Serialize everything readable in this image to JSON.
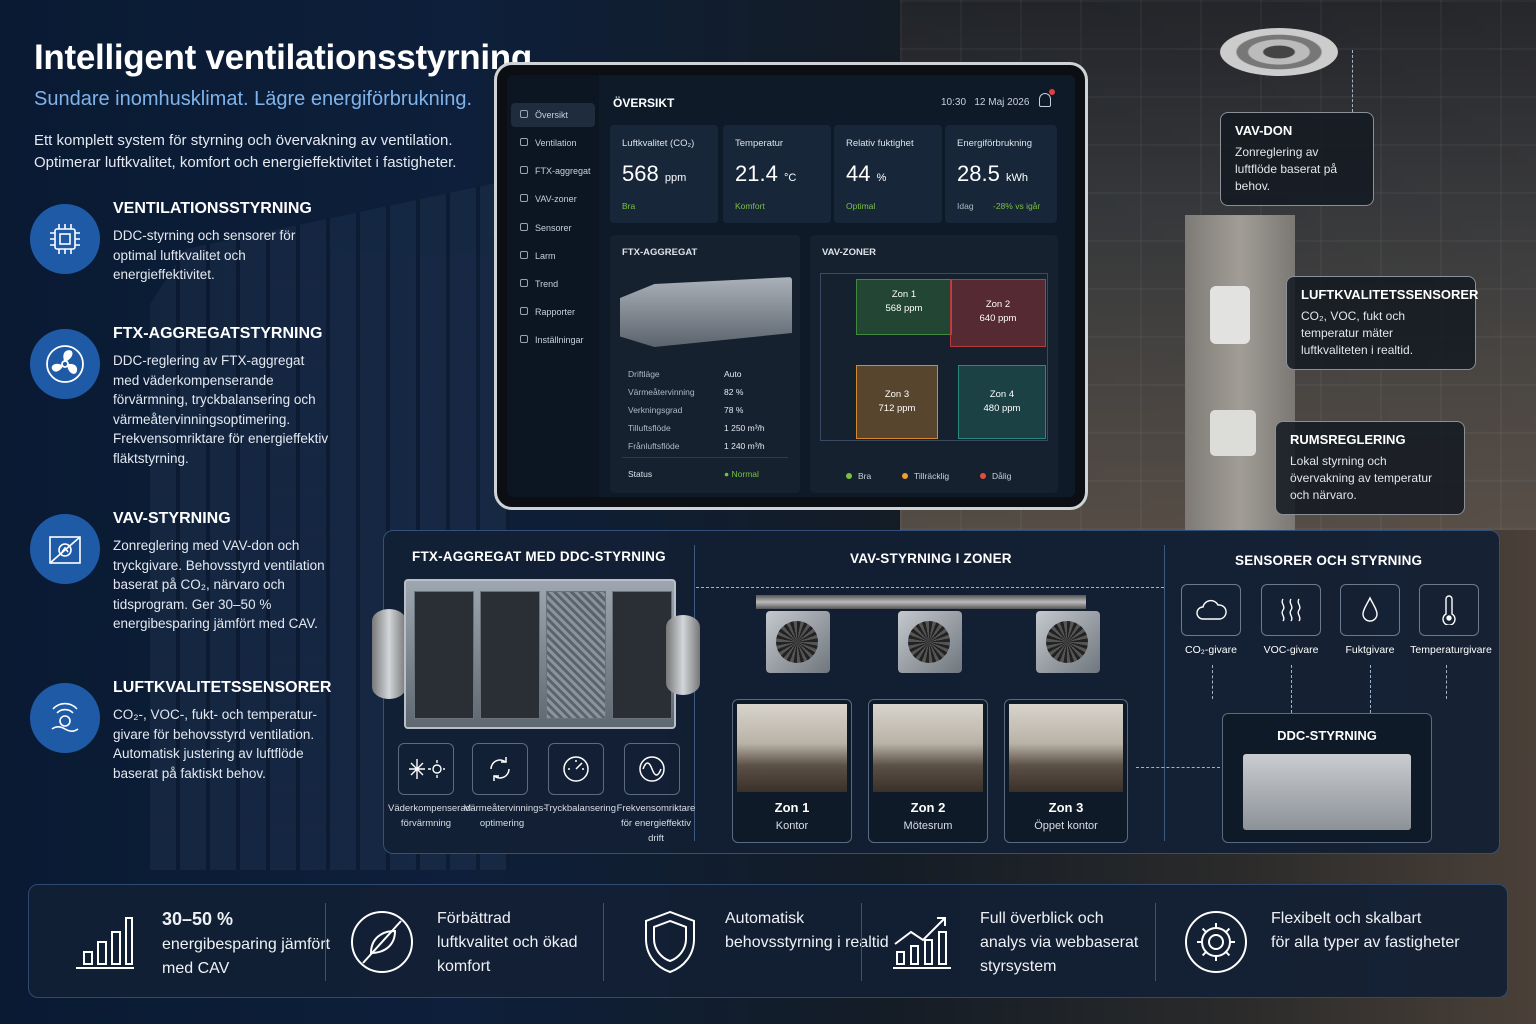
{
  "header": {
    "title": "Intelligent ventilationsstyrning",
    "subtitle": "Sundare inomhusklimat. Lägre energiförbrukning.",
    "intro": "Ett komplett system för styrning och övervakning av ventilation. Optimerar luftkvalitet, komfort och energieffektivitet i fastigheter."
  },
  "features": [
    {
      "title": "VENTILATIONSSTYRNING",
      "desc": "DDC-styrning och sensorer för optimal luftkvalitet och energieffektivitet.",
      "icon": "cpu-chip-icon"
    },
    {
      "title": "FTX-AGGREGATSTYRNING",
      "desc": "DDC-reglering av FTX-aggregat med väderkompenserande förvärmning, tryckbalansering och värmeåtervinningsoptimering. Frekvensomriktare för energieffektiv fläktstyrning.",
      "icon": "fan-icon"
    },
    {
      "title": "VAV-STYRNING",
      "desc": "Zonreglering med VAV-don och tryckgivare. Behovsstyrd ventilation baserat på CO₂, närvaro och tidsprogram. Ger 30–50 % energibesparing jämfört med CAV.",
      "icon": "damper-icon"
    },
    {
      "title": "LUFTKVALITETSSENSORER",
      "desc": "CO₂-, VOC-, fukt- och temperatur-givare för behovsstyrd ventilation. Automatisk justering av luftflöde baserat på faktiskt behov.",
      "icon": "air-sensor-icon"
    }
  ],
  "dashboard": {
    "title": "ÖVERSIKT",
    "time": "10:30",
    "date": "12 Maj 2026",
    "nav": [
      "Översikt",
      "Ventilation",
      "FTX-aggregat",
      "VAV-zoner",
      "Sensorer",
      "Larm",
      "Trend",
      "Rapporter",
      "Inställningar"
    ],
    "kpis": [
      {
        "label": "Luftkvalitet (CO₂)",
        "value": "568",
        "unit": "ppm",
        "status": "Bra"
      },
      {
        "label": "Temperatur",
        "value": "21.4",
        "unit": "°C",
        "status": "Komfort"
      },
      {
        "label": "Relativ fuktighet",
        "value": "44",
        "unit": "%",
        "status": "Optimal"
      },
      {
        "label": "Energiförbrukning",
        "value": "28.5",
        "unit": "kWh",
        "status": "Idag",
        "delta": "-28% vs igår"
      }
    ],
    "ftx_panel": {
      "title": "FTX-AGGREGAT",
      "rows": [
        {
          "label": "Driftläge",
          "value": "Auto"
        },
        {
          "label": "Värmeåtervinning",
          "value": "82 %"
        },
        {
          "label": "Verkningsgrad",
          "value": "78 %"
        },
        {
          "label": "Tilluftsflöde",
          "value": "1 250 m³/h"
        },
        {
          "label": "Frånluftsflöde",
          "value": "1 240 m³/h"
        }
      ],
      "status_label": "Status",
      "status_value": "Normal"
    },
    "vav_panel": {
      "title": "VAV-ZONER",
      "zones": [
        {
          "name": "Zon 1",
          "value": "568 ppm",
          "color": "#3e8a3e"
        },
        {
          "name": "Zon 2",
          "value": "640 ppm",
          "color": "#b83a3a"
        },
        {
          "name": "Zon 3",
          "value": "712 ppm",
          "color": "#d48a2a"
        },
        {
          "name": "Zon 4",
          "value": "480 ppm",
          "color": "#2a8a7a"
        }
      ],
      "legend": [
        {
          "label": "Bra",
          "color": "#7ac142"
        },
        {
          "label": "Tillräcklig",
          "color": "#f0a030"
        },
        {
          "label": "Dålig",
          "color": "#e05040"
        }
      ]
    }
  },
  "callouts": [
    {
      "title": "VAV-DON",
      "desc": "Zonreglering av luftflöde baserat på behov."
    },
    {
      "title": "LUFTKVALITETSSENSORER",
      "desc": "CO₂, VOC, fukt och temperatur mäter luftkvaliteten i realtid."
    },
    {
      "title": "RUMSREGLERING",
      "desc": "Lokal styrning och övervakning av temperatur och närvaro."
    }
  ],
  "schematic": {
    "ftx_title": "FTX-AGGREGAT MED DDC-STYRNING",
    "vav_title": "VAV-STYRNING I ZONER",
    "sensor_title": "SENSORER OCH STYRNING",
    "ftx_functions": [
      {
        "label": "Väderkompenserad förvärmning",
        "icon": "snow-sun-icon"
      },
      {
        "label": "Värmeåtervinnings- optimering",
        "icon": "recycle-icon"
      },
      {
        "label": "Tryckbalansering",
        "icon": "gauge-icon"
      },
      {
        "label": "Frekvensomriktare för energieffektiv drift",
        "icon": "sine-wave-icon"
      }
    ],
    "zones": [
      {
        "name": "Zon 1",
        "type": "Kontor"
      },
      {
        "name": "Zon 2",
        "type": "Mötesrum"
      },
      {
        "name": "Zon 3",
        "type": "Öppet kontor"
      }
    ],
    "sensors": [
      {
        "label": "CO₂-givare",
        "icon": "cloud-icon"
      },
      {
        "label": "VOC-givare",
        "icon": "waves-icon"
      },
      {
        "label": "Fuktgivare",
        "icon": "droplet-icon"
      },
      {
        "label": "Temperaturgivare",
        "icon": "thermometer-icon"
      }
    ],
    "ddc_title": "DDC-STYRNING"
  },
  "benefits": [
    {
      "line1": "30–50 %",
      "line2": "energibesparing jämfört med CAV",
      "icon": "bar-chart-icon"
    },
    {
      "line1": "Förbättrad",
      "line2": "luftkvalitet och ökad komfort",
      "icon": "leaf-icon"
    },
    {
      "line1": "Automatisk",
      "line2": "behovsstyrning i realtid",
      "icon": "shield-icon"
    },
    {
      "line1": "Full överblick och",
      "line2": "analys via webbaserat styrsystem",
      "icon": "trend-chart-icon"
    },
    {
      "line1": "Flexibelt och skalbart",
      "line2": "för alla typer av fastigheter",
      "icon": "gear-icon"
    }
  ]
}
